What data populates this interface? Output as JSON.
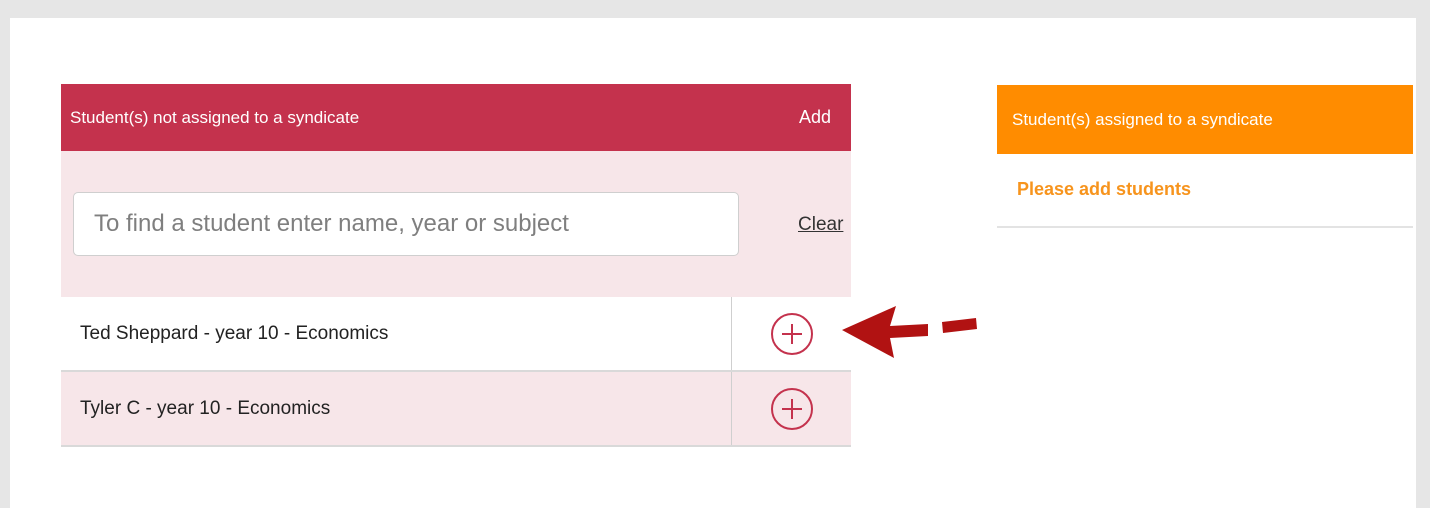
{
  "unassigned": {
    "header_title": "Student(s) not assigned to a syndicate",
    "header_add": "Add",
    "search": {
      "placeholder": "To find a student enter name, year or subject",
      "value": ""
    },
    "clear_label": "Clear",
    "students": [
      {
        "name": "Ted Sheppard - year 10 - Economics",
        "action_icon": "plus-circle-icon"
      },
      {
        "name": "Tyler C - year 10 - Economics",
        "action_icon": "plus-circle-icon"
      }
    ]
  },
  "assigned": {
    "header_title": "Student(s) assigned to a syndicate",
    "empty_message": "Please add students"
  },
  "colors": {
    "unassigned_header": "#c4324d",
    "unassigned_tint": "#f7e6e9",
    "assigned_header": "#ff8c00",
    "empty_message": "#f7941d",
    "annotation_arrow": "#b11212"
  }
}
